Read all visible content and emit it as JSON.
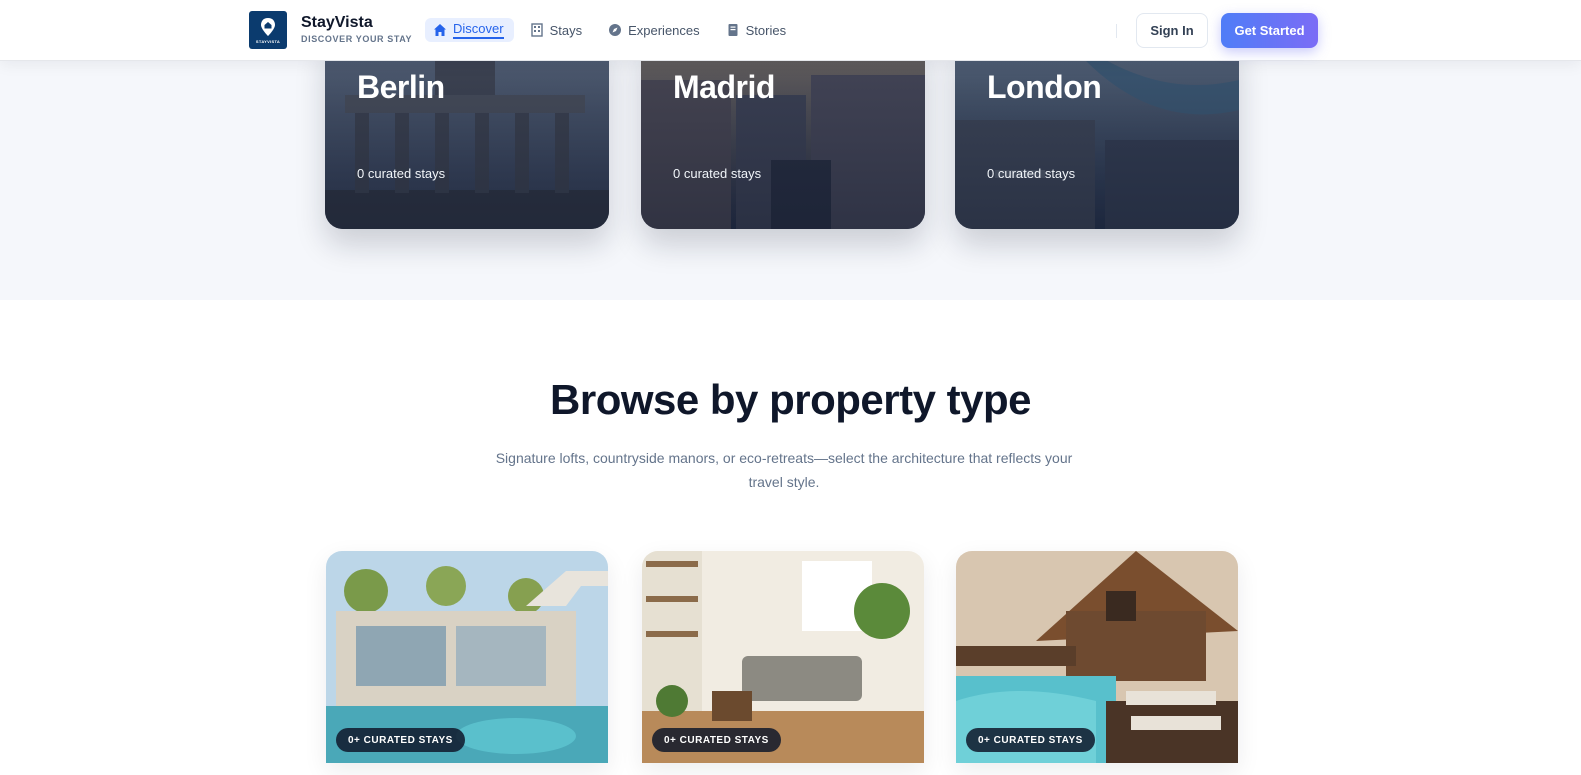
{
  "header": {
    "brand_name": "StayVista",
    "brand_tagline": "DISCOVER YOUR STAY",
    "logo_text": "STAYVISTA",
    "nav": [
      {
        "label": "Discover",
        "icon": "home-icon",
        "active": true
      },
      {
        "label": "Stays",
        "icon": "building-icon",
        "active": false
      },
      {
        "label": "Experiences",
        "icon": "compass-icon",
        "active": false
      },
      {
        "label": "Stories",
        "icon": "book-icon",
        "active": false
      }
    ],
    "sign_in_label": "Sign In",
    "get_started_label": "Get Started"
  },
  "cities": [
    {
      "name": "Berlin",
      "count": "0 curated stays"
    },
    {
      "name": "Madrid",
      "count": "0 curated stays"
    },
    {
      "name": "London",
      "count": "0 curated stays"
    }
  ],
  "property_types": {
    "title": "Browse by property type",
    "subtitle": "Signature lofts, countryside manors, or eco-retreats—select the architecture that reflects your travel style.",
    "cards": [
      {
        "badge": "0+ CURATED STAYS"
      },
      {
        "badge": "0+ CURATED STAYS"
      },
      {
        "badge": "0+ CURATED STAYS"
      }
    ]
  },
  "colors": {
    "accent": "#2563eb",
    "brand_navy": "#0b3b6e",
    "cta_gradient_start": "#4f7df7",
    "cta_gradient_end": "#7b6cf6"
  }
}
